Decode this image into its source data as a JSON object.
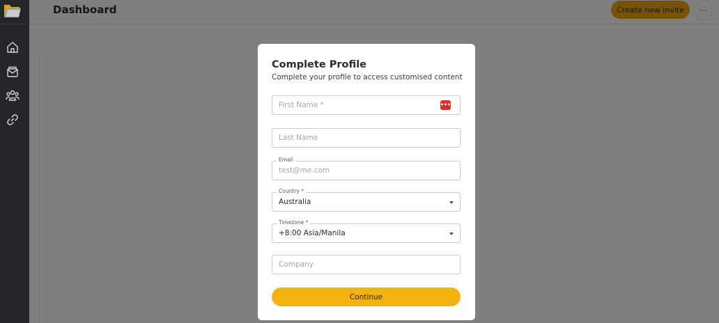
{
  "header": {
    "title": "Dashboard",
    "create_label": "Create new invite",
    "more_label": "···"
  },
  "sidebar": {
    "items": [
      {
        "icon": "home-icon"
      },
      {
        "icon": "mail-icon"
      },
      {
        "icon": "users-icon"
      },
      {
        "icon": "link-icon"
      }
    ]
  },
  "modal": {
    "title": "Complete Profile",
    "subtitle": "Complete your profile to access customised content",
    "first_name_placeholder": "First Name *",
    "last_name_placeholder": "Last Name",
    "email_label": "Email",
    "email_placeholder": "test@me.com",
    "country_label": "Country *",
    "country_value": "Australia",
    "timezone_label": "Timezone *",
    "timezone_value": "+8:00 Asia/Manila",
    "company_placeholder": "Company",
    "continue_label": "Continue",
    "password_manager_icon": "•••"
  },
  "colors": {
    "accent": "#f4b20f",
    "sidebar": "#25262a",
    "overlay": "rgba(0,0,0,0.5)",
    "pw_icon": "#d8302f"
  }
}
